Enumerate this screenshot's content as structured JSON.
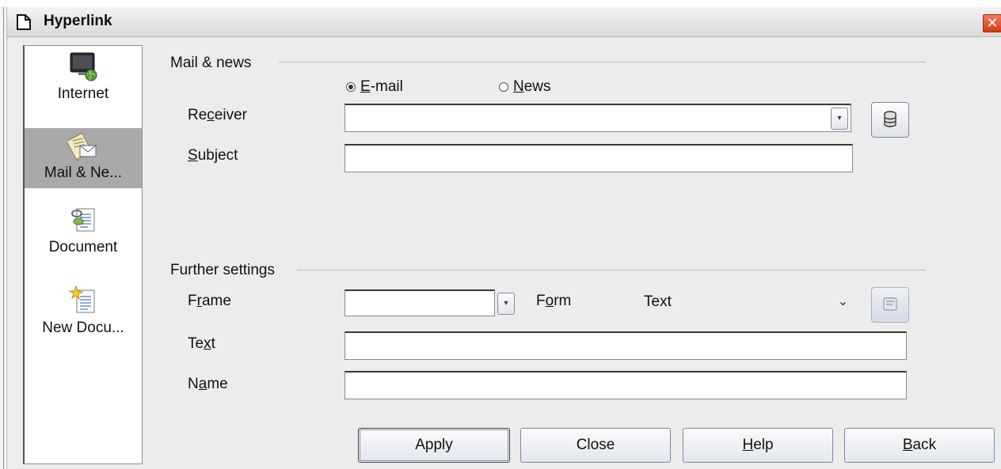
{
  "window": {
    "title": "Hyperlink",
    "close_glyph": "✕"
  },
  "sidebar": {
    "items": [
      {
        "label": "Internet",
        "icon": "internet-icon"
      },
      {
        "label": "Mail & Ne...",
        "icon": "mail-news-icon",
        "selected": true
      },
      {
        "label": "Document",
        "icon": "document-icon"
      },
      {
        "label": "New Docu...",
        "icon": "new-document-icon"
      }
    ]
  },
  "mail_news": {
    "heading": "Mail & news",
    "email_radio": {
      "pre": "",
      "underlined": "E",
      "post": "-mail",
      "checked": true
    },
    "news_radio": {
      "pre": "",
      "underlined": "N",
      "post": "ews",
      "checked": false
    },
    "receiver": {
      "pre": "Re",
      "underlined": "c",
      "post": "eiver",
      "value": ""
    },
    "subject": {
      "pre": "",
      "underlined": "S",
      "post": "ubject",
      "value": ""
    }
  },
  "further": {
    "heading": "Further settings",
    "frame": {
      "pre": "F",
      "underlined": "r",
      "post": "ame",
      "value": ""
    },
    "form": {
      "pre": "F",
      "underlined": "o",
      "post": "rm",
      "value": "Text"
    },
    "text": {
      "pre": "Te",
      "underlined": "x",
      "post": "t",
      "value": ""
    },
    "name": {
      "pre": "N",
      "underlined": "a",
      "post": "me",
      "value": ""
    }
  },
  "buttons": {
    "apply": {
      "pre": "Apply",
      "underlined": "",
      "post": ""
    },
    "close": {
      "pre": "Close",
      "underlined": "",
      "post": ""
    },
    "help": {
      "pre": "",
      "underlined": "H",
      "post": "elp"
    },
    "back": {
      "pre": "",
      "underlined": "B",
      "post": "ack"
    }
  }
}
